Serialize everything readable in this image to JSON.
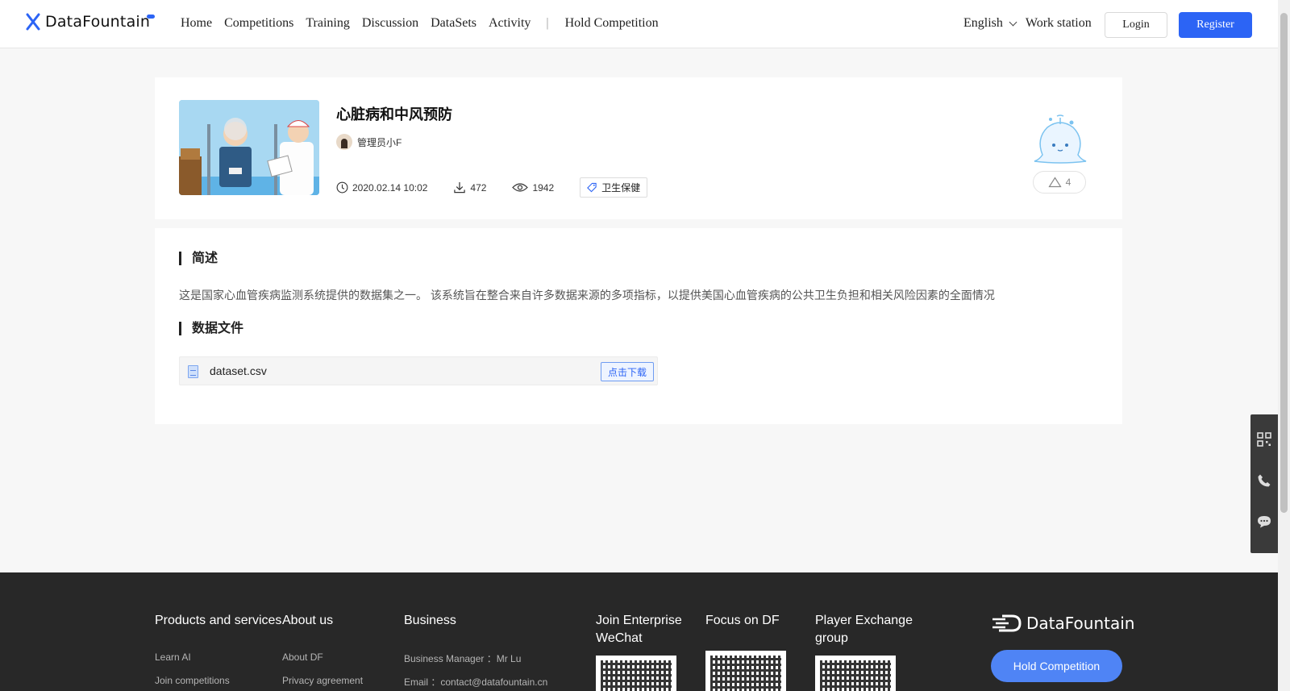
{
  "header": {
    "logo_text": "DataFountain",
    "nav": [
      "Home",
      "Competitions",
      "Training",
      "Discussion",
      "DataSets",
      "Activity"
    ],
    "nav_separator": "|",
    "hold_competition": "Hold Competition",
    "language": "English",
    "work_station": "Work station",
    "login": "Login",
    "register": "Register",
    "accent_color": "#2c64f5"
  },
  "dataset": {
    "title": "心脏病和中风预防",
    "author": "管理员小F",
    "date": "2020.02.14 10:02",
    "downloads": "472",
    "views": "1942",
    "tag": "卫生保健",
    "likes": "4"
  },
  "description": {
    "summary_title": "简述",
    "summary_text": "这是国家心血管疾病监测系统提供的数据集之一。 该系统旨在整合来自许多数据来源的多项指标，以提供美国心血管疾病的公共卫生负担和相关风险因素的全面情况",
    "files_title": "数据文件",
    "file_name": "dataset.csv",
    "download_label": "点击下载"
  },
  "side_bar": {
    "icons": [
      "qr-code-icon",
      "phone-icon",
      "chat-icon"
    ]
  },
  "footer": {
    "col1_title": "Products and services",
    "col1_links": [
      "Learn AI",
      "Join competitions"
    ],
    "col2_title": "About us",
    "col2_links": [
      "About DF",
      "Privacy agreement"
    ],
    "col3_title": "Business",
    "business_manager": "Business Manager ：Mr Lu",
    "email": "Email ：contact@datafountain.cn",
    "col4_title": "Join Enterprise WeChat",
    "col5_title": "Focus on DF",
    "col6_title": "Player Exchange group",
    "logo_text": "DataFountain",
    "hold_competition": "Hold Competition"
  }
}
